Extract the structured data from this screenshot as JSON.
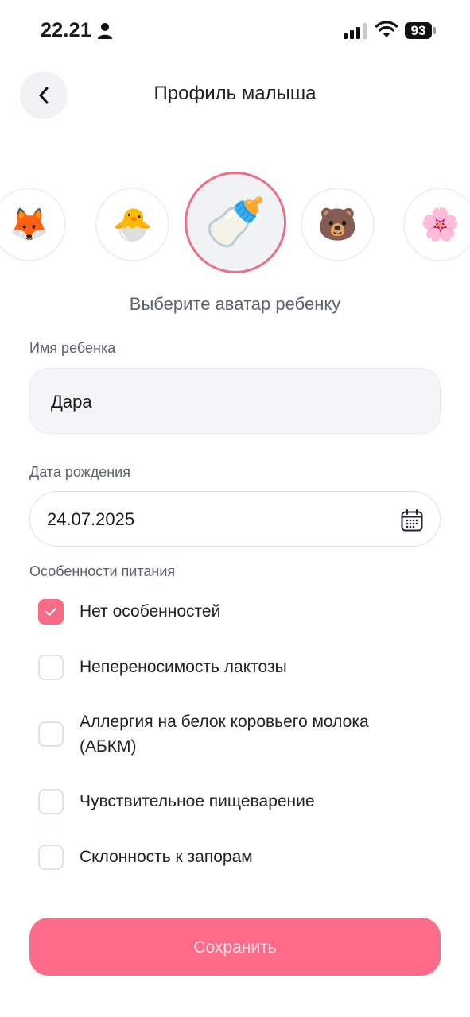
{
  "status_bar": {
    "time": "22.21",
    "battery": "93"
  },
  "header": {
    "title": "Профиль малыша"
  },
  "avatars": {
    "items": [
      {
        "emoji": "🦊",
        "name": "fox"
      },
      {
        "emoji": "🐣",
        "name": "chick"
      },
      {
        "emoji": "🍼",
        "name": "baby-bottle"
      },
      {
        "emoji": "🐻",
        "name": "bear"
      },
      {
        "emoji": "🌸",
        "name": "flower"
      }
    ],
    "selected": "baby-bottle",
    "caption": "Выберите аватар ребенку"
  },
  "form": {
    "name_label": "Имя ребенка",
    "name_value": "Дара",
    "birth_label": "Дата рождения",
    "birth_value": "24.07.2025",
    "diet_label": "Особенности питания",
    "options": [
      {
        "label": "Нет особенностей",
        "checked": true
      },
      {
        "label": "Непереносимость лактозы",
        "checked": false
      },
      {
        "label": "Аллергия на белок коровьего молока (АБКМ)",
        "checked": false
      },
      {
        "label": "Чувствительное пищеварение",
        "checked": false
      },
      {
        "label": "Склонность к запорам",
        "checked": false
      }
    ]
  },
  "save_label": "Сохранить",
  "colors": {
    "accent": "#ff6b88",
    "selected_border": "#ee6f86"
  }
}
